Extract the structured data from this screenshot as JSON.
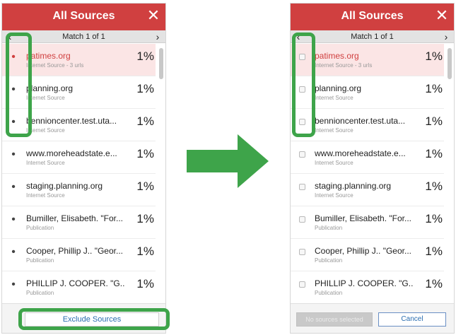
{
  "panel": {
    "title": "All Sources",
    "close_glyph": "✕",
    "match_text": "Match 1 of 1",
    "prev_glyph": "‹",
    "next_glyph": "›"
  },
  "sources": [
    {
      "name": "patimes.org",
      "sub": "Internet Source - 3 urls",
      "pct": "1%"
    },
    {
      "name": "planning.org",
      "sub": "Internet Source",
      "pct": "1%"
    },
    {
      "name": "bennioncenter.test.uta...",
      "sub": "Internet Source",
      "pct": "1%"
    },
    {
      "name": "www.moreheadstate.e...",
      "sub": "Internet Source",
      "pct": "1%"
    },
    {
      "name": "staging.planning.org",
      "sub": "Internet Source",
      "pct": "1%"
    },
    {
      "name": "Bumiller, Elisabeth. \"For...",
      "sub": "Publication",
      "pct": "1%"
    },
    {
      "name": "Cooper, Phillip J.. \"Geor...",
      "sub": "Publication",
      "pct": "1%"
    },
    {
      "name": "PHILLIP J. COOPER. \"G...",
      "sub": "Publication",
      "pct": "1%"
    }
  ],
  "left_footer": {
    "exclude_label": "Exclude Sources"
  },
  "right_footer": {
    "no_sources_label": "No sources selected",
    "cancel_label": "Cancel"
  },
  "icons": {
    "header_close": "close-icon",
    "prev": "chevron-left-icon",
    "next": "chevron-right-icon",
    "arrow": "arrow-right-icon"
  },
  "colors": {
    "header_red": "#d04040",
    "selected_row": "#fbe5e5",
    "highlight_green": "#3ea44a",
    "arrow_green": "#3ea44a",
    "link_blue": "#2a6db0"
  }
}
